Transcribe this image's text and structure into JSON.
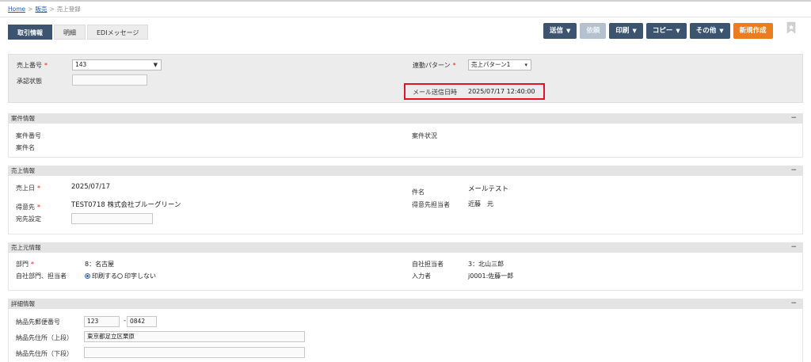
{
  "breadcrumb": {
    "home": "Home",
    "sales": "販売",
    "current": "売上登録",
    "sep": ">"
  },
  "tabs": [
    {
      "label": "取引情報",
      "active": true
    },
    {
      "label": "明細",
      "active": false
    },
    {
      "label": "EDIメッセージ",
      "active": false
    }
  ],
  "actions": {
    "send": "送信",
    "request": "依頼",
    "print": "印刷",
    "copy": "コピー",
    "other": "その他",
    "create_new": "新規作成",
    "caret": "▼",
    "pin_icon": "pin-icon"
  },
  "header": {
    "sales_number_label": "売上番号",
    "sales_number_value": "143",
    "approval_status_label": "承認状態",
    "approval_status_value": "",
    "link_pattern_label": "連動パターン",
    "link_pattern_value": "売上パターン1",
    "mail_sent_label": "メール送信日時",
    "mail_sent_value": "2025/07/17 12:40:00",
    "required_mark": "*"
  },
  "project_info": {
    "title": "案件情報",
    "project_number_label": "案件番号",
    "project_number_value": "",
    "project_name_label": "案件名",
    "project_name_value": "",
    "project_status_label": "案件状況",
    "project_status_value": ""
  },
  "sales_info": {
    "title": "売上情報",
    "sales_date_label": "売上日",
    "sales_date_value": "2025/07/17",
    "customer_label": "得意先",
    "customer_value": "TEST0718 株式会社ブルーグリーン",
    "addressee_label": "宛先設定",
    "addressee_value": "",
    "subject_label": "件名",
    "subject_value": "メールテスト",
    "customer_rep_label": "得意先担当者",
    "customer_rep_value": "近藤　元"
  },
  "seller_info": {
    "title": "売上元情報",
    "department_label": "部門",
    "department_value": "8：名古屋",
    "own_dept_label": "自社部門、担当者",
    "print_yes": "印刷する",
    "print_no": "印字しない",
    "own_rep_label": "自社担当者",
    "own_rep_value": "3：北山三郎",
    "entered_by_label": "入力者",
    "entered_by_value": "j0001:佐藤一郎"
  },
  "detail_info": {
    "title": "詳細情報",
    "postal_label": "納品先郵便番号",
    "postal_1": "123",
    "postal_dash": "-",
    "postal_2": "0842",
    "address_upper_label": "納品先住所（上段）",
    "address_upper_value": "東京都足立区栗原",
    "address_lower_label": "納品先住所（下段）",
    "address_lower_value": ""
  },
  "collapse_symbol": "−",
  "colors": {
    "primary": "#3c5470",
    "accent": "#e97d1f",
    "highlight": "#e0161e"
  }
}
